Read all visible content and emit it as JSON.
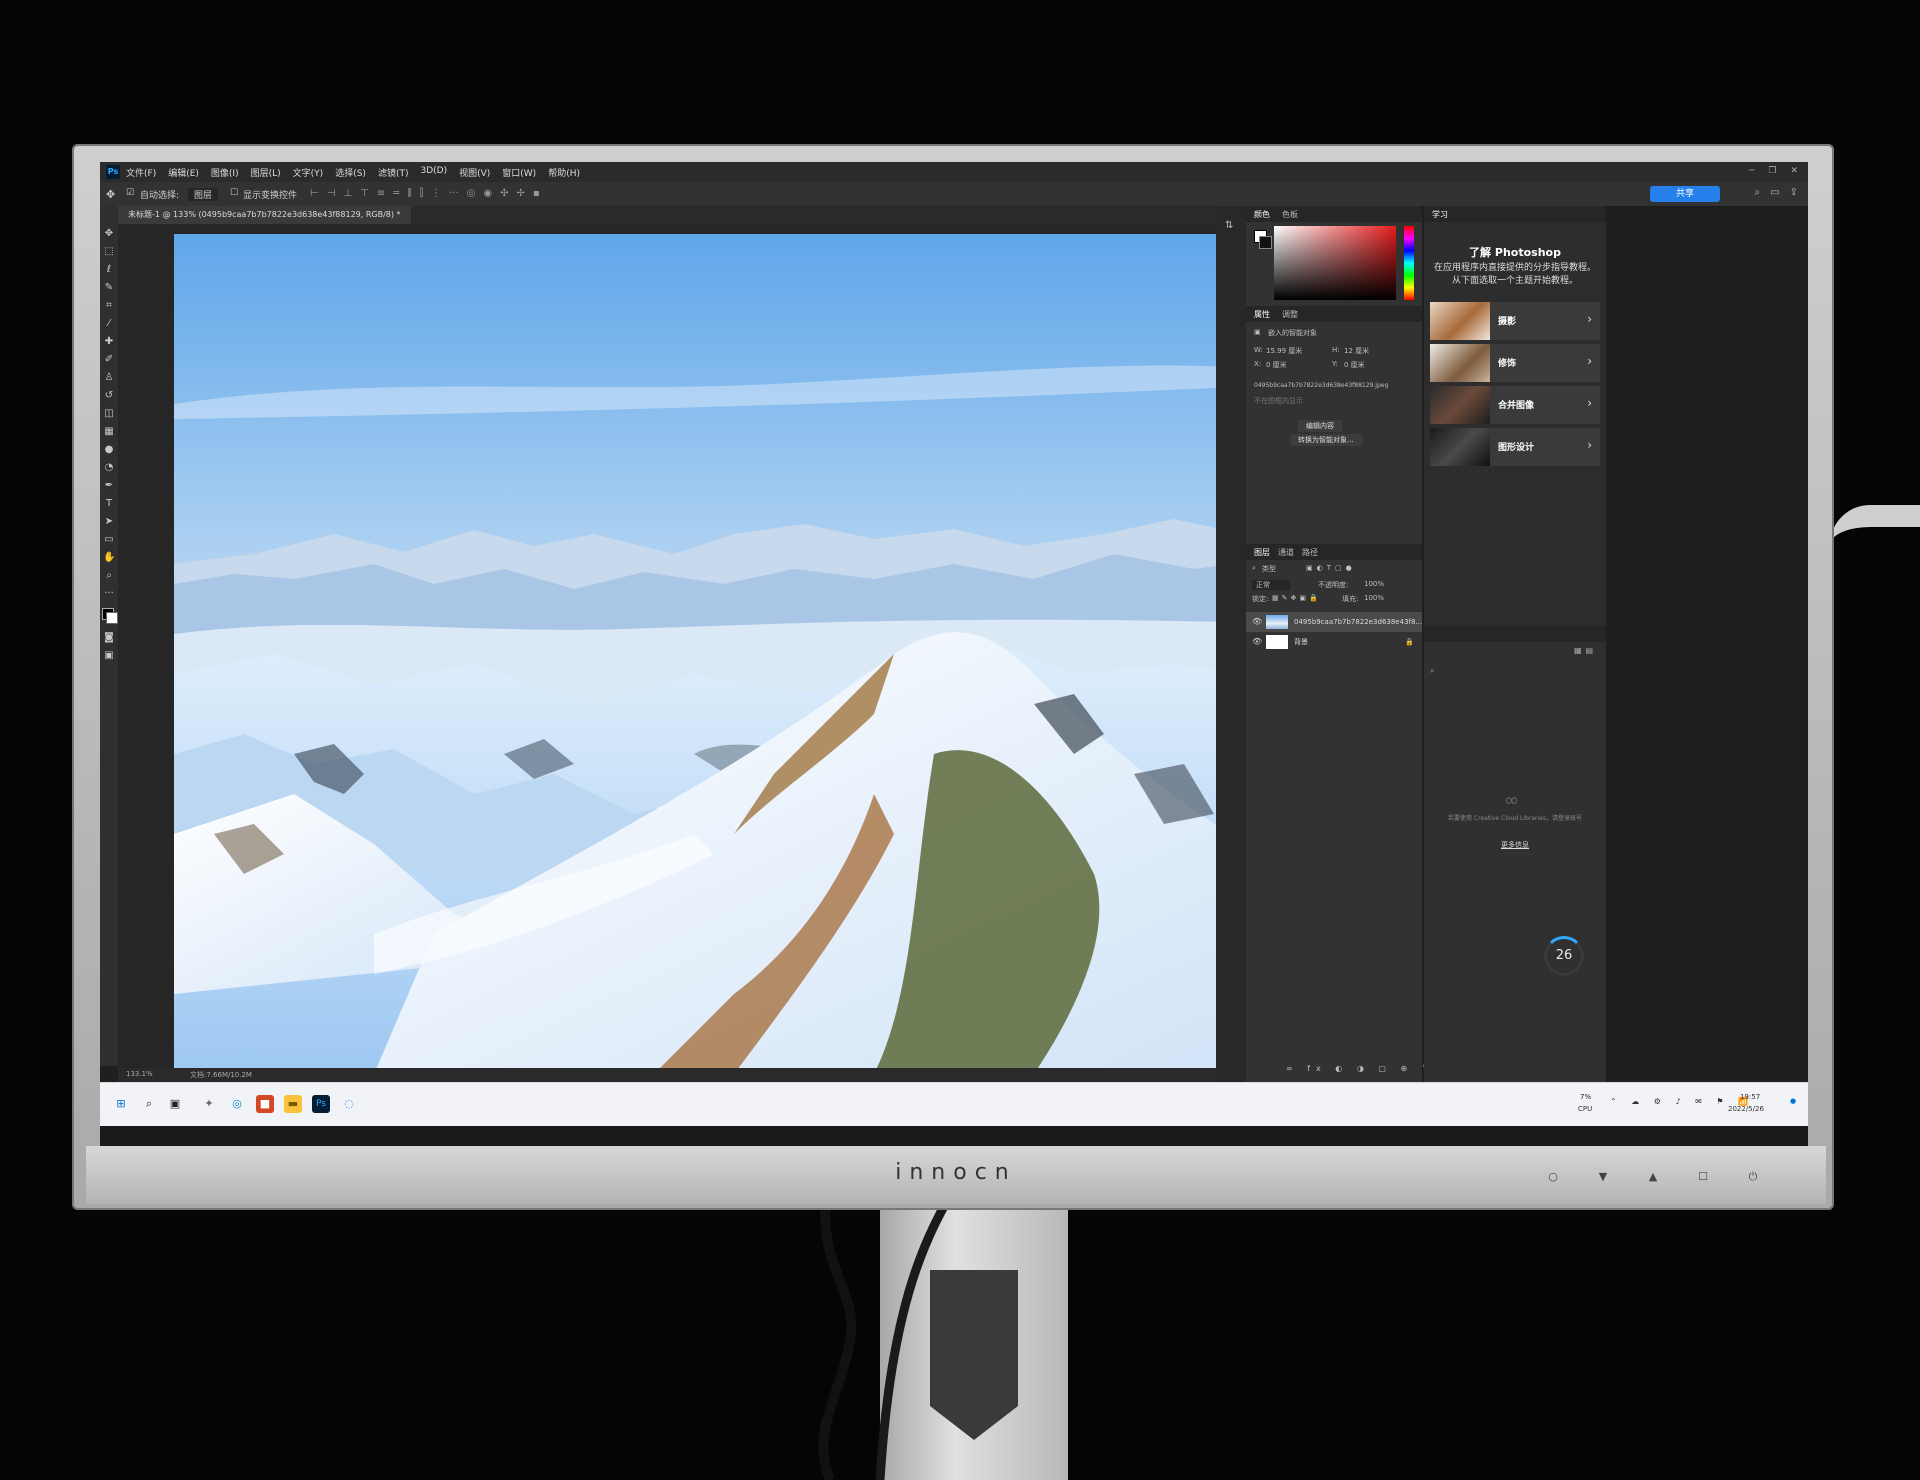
{
  "monitor": {
    "brand": "innocn",
    "chin_buttons": [
      "○",
      "▼",
      "▲",
      "☐",
      "⏻"
    ]
  },
  "photoshop": {
    "logo_text": "Ps",
    "menu": [
      "文件(F)",
      "编辑(E)",
      "图像(I)",
      "图层(L)",
      "文字(Y)",
      "选择(S)",
      "滤镜(T)",
      "3D(D)",
      "视图(V)",
      "窗口(W)",
      "帮助(H)"
    ],
    "window_controls": [
      "─",
      "❐",
      "✕"
    ],
    "options": {
      "auto_select_label": "自动选择:",
      "auto_select_value": "图层",
      "show_transform": "显示变换控件",
      "share_label": "共享"
    },
    "doc_tab": "未标题-1 @ 133% (0495b9caa7b7b7822e3d638e43f88129, RGB/8) *",
    "status": {
      "zoom": "133.1%",
      "doc_size": "文档:7.66M/10.2M"
    },
    "panels": {
      "color_tabs": [
        "颜色",
        "色板"
      ],
      "properties_tabs": [
        "属性",
        "调整"
      ],
      "properties": {
        "kind": "嵌入的智能对象",
        "w_label": "W:",
        "w_value": "15.99 厘米",
        "h_label": "H:",
        "h_value": "12 厘米",
        "x_label": "X:",
        "x_value": "0 厘米",
        "y_label": "Y:",
        "y_value": "0 厘米",
        "filename": "0495b9caa7b7b7822e3d638e43f88129.jpeg",
        "linked_note": "不在图框内显示",
        "edit_contents": "编辑内容",
        "convert_to_layers": "转换为智能对象..."
      },
      "layers_tabs": [
        "图层",
        "通道",
        "路径"
      ],
      "layers_filter": "类型",
      "blend_mode": "正常",
      "opacity_label": "不透明度:",
      "opacity_value": "100%",
      "lock_label": "锁定:",
      "fill_label": "填充:",
      "fill_value": "100%",
      "layers": [
        {
          "name": "0495b9caa7b7b7822e3d638e43f8...",
          "selected": true
        },
        {
          "name": "背景",
          "selected": false
        }
      ],
      "learn_tab": "学习",
      "learn_title": "了解 Photoshop",
      "learn_desc": "在应用程序内直接提供的分步指导教程。从下面选取一个主题开始教程。",
      "learn_items": [
        {
          "label": "摄影"
        },
        {
          "label": "修饰"
        },
        {
          "label": "合并图像"
        },
        {
          "label": "图形设计"
        }
      ],
      "library_note": "若要使用 Creative Cloud Libraries，请登录账号",
      "library_link": "更多信息",
      "cpu_gauge": "26"
    }
  },
  "taskbar": {
    "cpu_label": "CPU",
    "cpu_value": "7%",
    "time": "19:57",
    "date": "2022/5/26"
  },
  "colors": {
    "ps_blue": "#31a8ff",
    "ps_dark": "#323232",
    "share_blue": "#2680eb"
  }
}
